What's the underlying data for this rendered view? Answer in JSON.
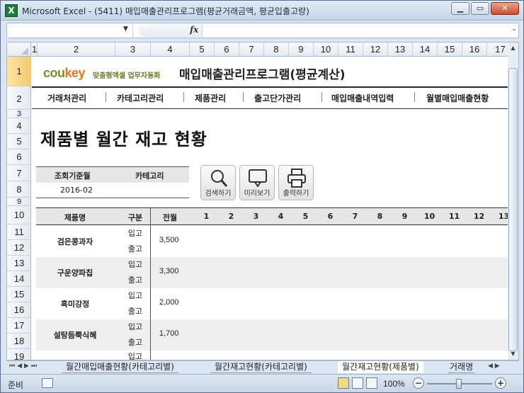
{
  "window": {
    "title": "Microsoft Excel - (5411) 매입매출관리프로그램(평균거래금액, 평균입출고량)",
    "app_icon": "X"
  },
  "formula_bar": {
    "name_box": "",
    "fx": "fx",
    "content": ""
  },
  "columns": [
    "1",
    "2",
    "3",
    "4",
    "5",
    "6",
    "7",
    "8",
    "9",
    "10",
    "11",
    "12",
    "13",
    "14",
    "15",
    "16",
    "17"
  ],
  "rows": [
    "1",
    "2",
    "3",
    "4",
    "5",
    "6",
    "7",
    "8",
    "9",
    "10",
    "11",
    "12",
    "13",
    "14",
    "15",
    "16",
    "17",
    "18",
    "19"
  ],
  "brand": {
    "logo_a": "cou",
    "logo_b": "key",
    "subtitle": "맞춤형엑셀 업무자동화"
  },
  "app_title": "매입매출관리프로그램(평균계산)",
  "menu": [
    "거래처관리",
    "카테고리관리",
    "제품관리",
    "출고단가관리",
    "매입매출내역입력",
    "월별매입매출현황"
  ],
  "page_title": "제품별 월간 재고 현황",
  "filter": {
    "date_label": "조회기준월",
    "category_label": "카테고리",
    "date_value": "2016-02",
    "category_value": ""
  },
  "buttons": {
    "search": "검색하기",
    "preview": "미리보기",
    "print": "출력하기"
  },
  "table": {
    "headers": {
      "name": "제품명",
      "type": "구분",
      "prev": "전월"
    },
    "months": [
      "1",
      "2",
      "3",
      "4",
      "5",
      "6",
      "7",
      "8",
      "9",
      "10",
      "11",
      "12",
      "13"
    ],
    "type_in": "입고",
    "type_out": "출고",
    "products": [
      {
        "name": "검은콩과자",
        "prev": "3,500"
      },
      {
        "name": "구운양파칩",
        "prev": "3,300"
      },
      {
        "name": "흑미강정",
        "prev": "2,000"
      },
      {
        "name": "설탕듬뿍식혜",
        "prev": "1,700"
      }
    ]
  },
  "sheets": [
    "월간매입매출현황(카테고리별)",
    "월간재고현황(카테고리별)",
    "월간재고현황(제품별)",
    "거래명"
  ],
  "active_sheet": "월간재고현황(제품별)",
  "status": {
    "ready": "준비",
    "zoom": "100%"
  }
}
